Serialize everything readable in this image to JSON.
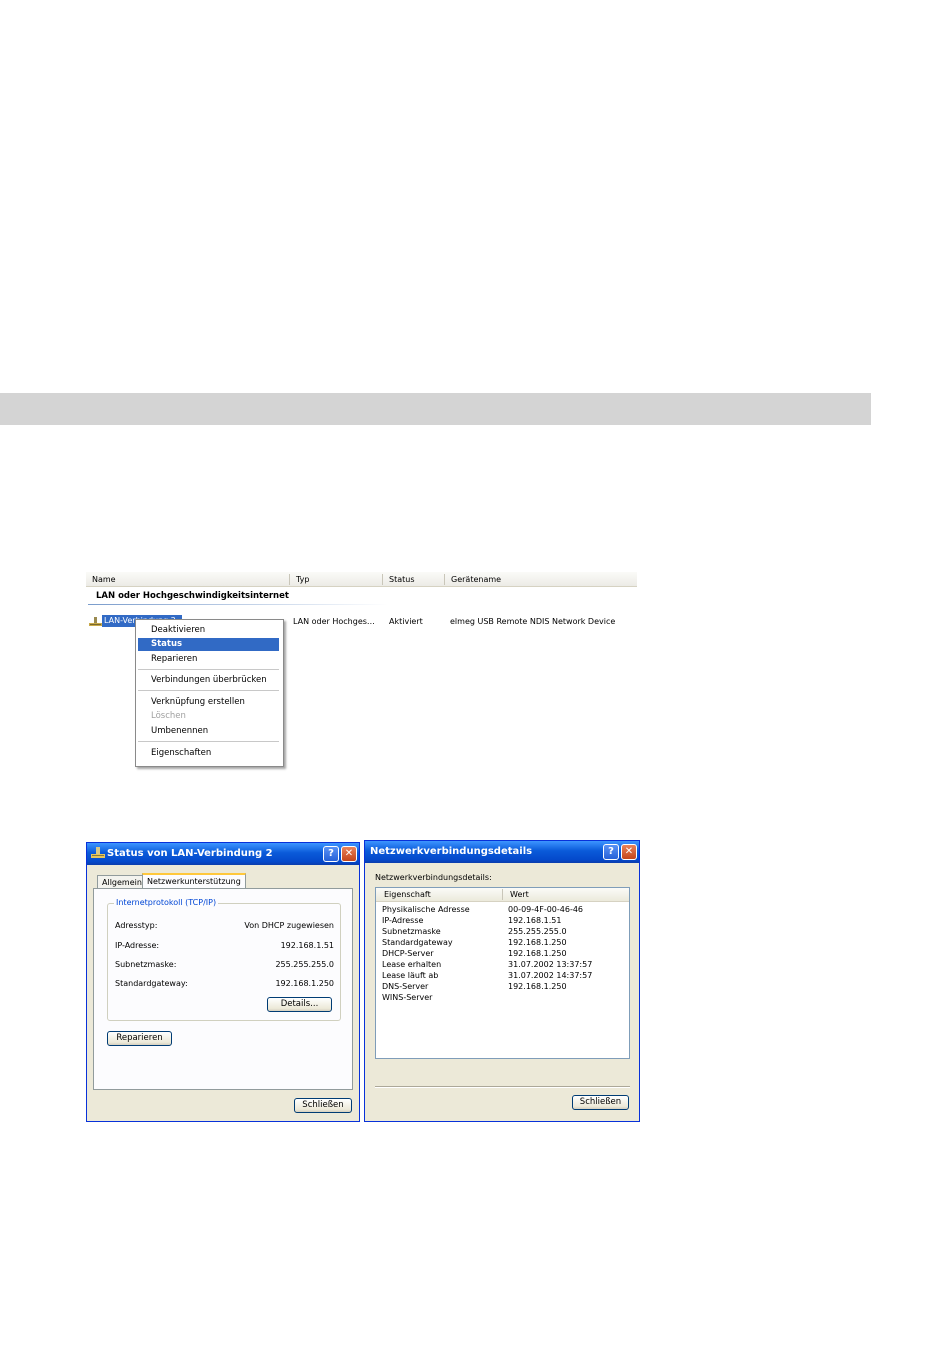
{
  "explorer": {
    "columns": [
      "Name",
      "Typ",
      "Status",
      "Gerätename"
    ],
    "group_title": "LAN oder Hochgeschwindigkeitsinternet",
    "connection": {
      "name": "LAN-Verbindung 2",
      "type": "LAN oder Hochges…",
      "status": "Aktiviert",
      "device": "elmeg USB Remote NDIS Network Device"
    },
    "context_menu": {
      "items": [
        {
          "label": "Deaktivieren",
          "state": "normal"
        },
        {
          "label": "Status",
          "state": "highlighted"
        },
        {
          "label": "Reparieren",
          "state": "normal"
        },
        {
          "label": "Verbindungen überbrücken",
          "state": "normal"
        },
        {
          "label": "Verknüpfung erstellen",
          "state": "normal"
        },
        {
          "label": "Löschen",
          "state": "disabled"
        },
        {
          "label": "Umbenennen",
          "state": "normal"
        },
        {
          "label": "Eigenschaften",
          "state": "normal"
        }
      ]
    }
  },
  "status_dialog": {
    "title": "Status von LAN-Verbindung 2",
    "help_glyph": "?",
    "close_glyph": "✕",
    "tabs": [
      "Allgemein",
      "Netzwerkunterstützung"
    ],
    "active_tab": 1,
    "group_title": "Internetprotokoll (TCP/IP)",
    "fields": [
      {
        "label": "Adresstyp:",
        "value": "Von DHCP zugewiesen"
      },
      {
        "label": "IP-Adresse:",
        "value": "192.168.1.51"
      },
      {
        "label": "Subnetzmaske:",
        "value": "255.255.255.0"
      },
      {
        "label": "Standardgateway:",
        "value": "192.168.1.250"
      }
    ],
    "details_button": "Details...",
    "repair_button": "Reparieren",
    "close_button": "Schließen"
  },
  "details_dialog": {
    "title": "Netzwerkverbindungsdetails",
    "help_glyph": "?",
    "close_glyph": "✕",
    "caption": "Netzwerkverbindungsdetails:",
    "columns": [
      "Eigenschaft",
      "Wert"
    ],
    "rows": [
      {
        "property": "Physikalische Adresse",
        "value": "00-09-4F-00-46-46"
      },
      {
        "property": "IP-Adresse",
        "value": "192.168.1.51"
      },
      {
        "property": "Subnetzmaske",
        "value": "255.255.255.0"
      },
      {
        "property": "Standardgateway",
        "value": "192.168.1.250"
      },
      {
        "property": "DHCP-Server",
        "value": "192.168.1.250"
      },
      {
        "property": "Lease erhalten",
        "value": "31.07.2002 13:37:57"
      },
      {
        "property": "Lease läuft ab",
        "value": "31.07.2002 14:37:57"
      },
      {
        "property": "DNS-Server",
        "value": "192.168.1.250"
      },
      {
        "property": "WINS-Server",
        "value": ""
      }
    ],
    "close_button": "Schließen"
  }
}
